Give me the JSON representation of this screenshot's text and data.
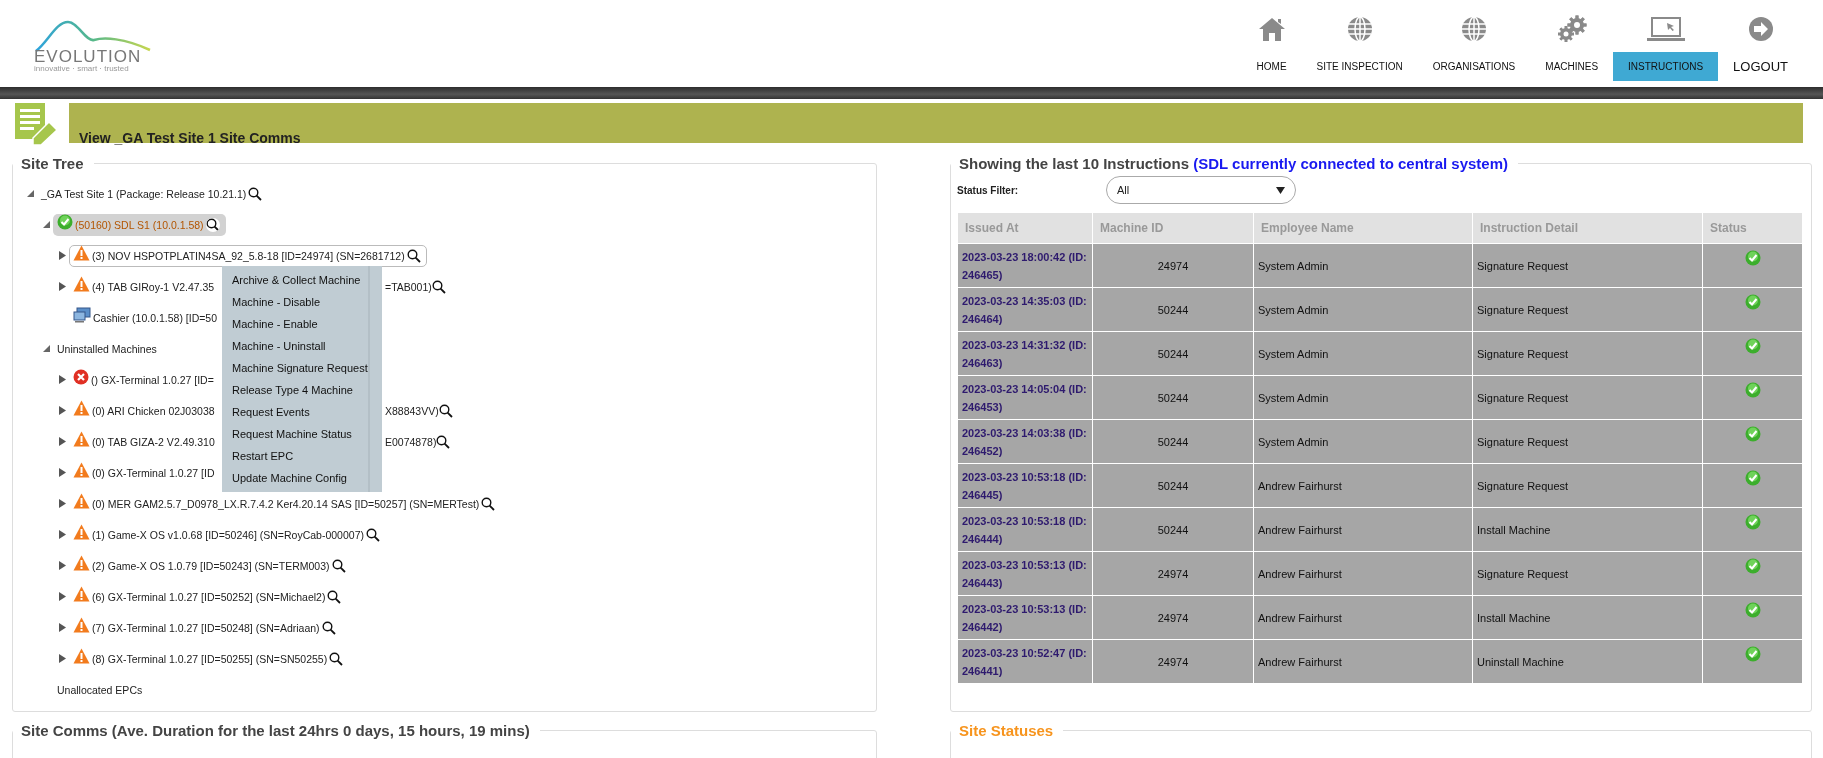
{
  "header": {
    "logo": {
      "name": "EVOLUTION",
      "tagline": "innovative · smart · trusted"
    },
    "nav": [
      {
        "label": "HOME",
        "kind": "tab",
        "selected": false
      },
      {
        "label": "SITE INSPECTION",
        "kind": "tab",
        "selected": false
      },
      {
        "label": "ORGANISATIONS",
        "kind": "tab",
        "selected": false
      },
      {
        "label": "MACHINES",
        "kind": "tab",
        "selected": false
      },
      {
        "label": "INSTRUCTIONS",
        "kind": "tab",
        "selected": true
      },
      {
        "label": "LOGOUT",
        "kind": "action",
        "selected": false
      }
    ]
  },
  "banner": {
    "title": "View _GA Test Site 1 Site Comms"
  },
  "site_tree": {
    "legend": "Site Tree",
    "nodes": [
      {
        "text": "_GA Test Site 1 (Package: Release 10.21.1)",
        "expanded": true,
        "selected": false,
        "outlined": false,
        "search_icon": true,
        "children": [
          {
            "text": "(50160) SDL S1 (10.0.1.58)",
            "kind": "ok",
            "expanded": true,
            "selected": true,
            "outlined": false,
            "search_icon": true,
            "children": [
              {
                "text": "(3) NOV HSPOTPLATIN4SA_92_5.8-18 [ID=24974] (SN=2681712)",
                "kind": "warning",
                "expanded": false,
                "selected": false,
                "outlined": true,
                "search_icon": true,
                "context_menu": [
                  "Archive & Collect Machine",
                  "Machine - Disable",
                  "Machine - Enable",
                  "Machine - Uninstall",
                  "Machine Signature Request",
                  "Release Type 4 Machine",
                  "Request Events",
                  "Request Machine Status",
                  "Restart EPC",
                  "Update Machine Config"
                ]
              },
              {
                "text": "(4) TAB GIRoy-1 V2.47.35",
                "text_after": "=TAB001)",
                "kind": "warning",
                "expanded": false,
                "selected": false,
                "outlined": false,
                "search_icon": true
              },
              {
                "text": "Cashier (10.0.1.58) [ID=50",
                "kind": "pc",
                "selected": false,
                "outlined": false,
                "search_icon": false
              }
            ]
          },
          {
            "text": "Uninstalled Machines",
            "expanded": true,
            "selected": false,
            "outlined": false,
            "search_icon": false,
            "children": [
              {
                "text": "() GX-Terminal 1.0.27 [ID=",
                "kind": "error",
                "expanded": false,
                "selected": false,
                "outlined": false,
                "search_icon": false
              },
              {
                "text": "(0) ARI Chicken 02J03038",
                "text_after": "X88843VV)",
                "kind": "warning",
                "expanded": false,
                "selected": false,
                "outlined": false,
                "search_icon": true
              },
              {
                "text": "(0) TAB GIZA-2 V2.49.310",
                "text_after": "E0074878)",
                "kind": "warning",
                "expanded": false,
                "selected": false,
                "outlined": false,
                "search_icon": true
              },
              {
                "text": "(0) GX-Terminal 1.0.27 [ID",
                "kind": "warning",
                "expanded": false,
                "selected": false,
                "outlined": false,
                "search_icon": false
              },
              {
                "text": "(0) MER GAM2.5.7_D0978_LX.R.7.4.2 Ker4.20.14 SAS [ID=50257] (SN=MERTest)",
                "kind": "warning",
                "expanded": false,
                "selected": false,
                "outlined": false,
                "search_icon": true
              },
              {
                "text": "(1) Game-X OS v1.0.68 [ID=50246] (SN=RoyCab-000007)",
                "kind": "warning",
                "expanded": false,
                "selected": false,
                "outlined": false,
                "search_icon": true
              },
              {
                "text": "(2) Game-X OS 1.0.79 [ID=50243] (SN=TERM003)",
                "kind": "warning",
                "expanded": false,
                "selected": false,
                "outlined": false,
                "search_icon": true
              },
              {
                "text": "(6) GX-Terminal 1.0.27 [ID=50252] (SN=Michael2)",
                "kind": "warning",
                "expanded": false,
                "selected": false,
                "outlined": false,
                "search_icon": true
              },
              {
                "text": "(7) GX-Terminal 1.0.27 [ID=50248] (SN=Adriaan)",
                "kind": "warning",
                "expanded": false,
                "selected": false,
                "outlined": false,
                "search_icon": true
              },
              {
                "text": "(8) GX-Terminal 1.0.27 [ID=50255] (SN=SN50255)",
                "kind": "warning",
                "expanded": false,
                "selected": false,
                "outlined": false,
                "search_icon": true
              }
            ]
          },
          {
            "text": "Unallocated EPCs",
            "selected": false,
            "outlined": false,
            "search_icon": false
          }
        ]
      }
    ]
  },
  "instructions": {
    "legend": "Showing the last 10 Instructions",
    "legend_note": "(SDL currently connected to central system)",
    "status_filter": {
      "label": "Status Filter:",
      "value": "All"
    },
    "table": {
      "columns": [
        "Issued At",
        "Machine ID",
        "Employee Name",
        "Instruction Detail",
        "Status"
      ],
      "rows": [
        {
          "issued_at": "2023-03-23 18:00:42 (ID: 246465)",
          "machine_id": "24974",
          "employee": "System Admin",
          "detail": "Signature Request",
          "completed": true
        },
        {
          "issued_at": "2023-03-23 14:35:03 (ID: 246464)",
          "machine_id": "50244",
          "employee": "System Admin",
          "detail": "Signature Request",
          "completed": true
        },
        {
          "issued_at": "2023-03-23 14:31:32 (ID: 246463)",
          "machine_id": "50244",
          "employee": "System Admin",
          "detail": "Signature Request",
          "completed": true
        },
        {
          "issued_at": "2023-03-23 14:05:04 (ID: 246453)",
          "machine_id": "50244",
          "employee": "System Admin",
          "detail": "Signature Request",
          "completed": true
        },
        {
          "issued_at": "2023-03-23 14:03:38 (ID: 246452)",
          "machine_id": "50244",
          "employee": "System Admin",
          "detail": "Signature Request",
          "completed": true
        },
        {
          "issued_at": "2023-03-23 10:53:18 (ID: 246445)",
          "machine_id": "50244",
          "employee": "Andrew Fairhurst",
          "detail": "Signature Request",
          "completed": true
        },
        {
          "issued_at": "2023-03-23 10:53:18 (ID: 246444)",
          "machine_id": "50244",
          "employee": "Andrew Fairhurst",
          "detail": "Install Machine",
          "completed": true
        },
        {
          "issued_at": "2023-03-23 10:53:13 (ID: 246443)",
          "machine_id": "24974",
          "employee": "Andrew Fairhurst",
          "detail": "Signature Request",
          "completed": true
        },
        {
          "issued_at": "2023-03-23 10:53:13 (ID: 246442)",
          "machine_id": "24974",
          "employee": "Andrew Fairhurst",
          "detail": "Install Machine",
          "completed": true
        },
        {
          "issued_at": "2023-03-23 10:52:47 (ID: 246441)",
          "machine_id": "24974",
          "employee": "Andrew Fairhurst",
          "detail": "Uninstall Machine",
          "completed": true
        }
      ]
    }
  },
  "site_comms": {
    "legend": "Site Comms (Ave. Duration for the last 24hrs 0 days, 15 hours, 19 mins)"
  },
  "site_statuses": {
    "legend": "Site Statuses"
  }
}
